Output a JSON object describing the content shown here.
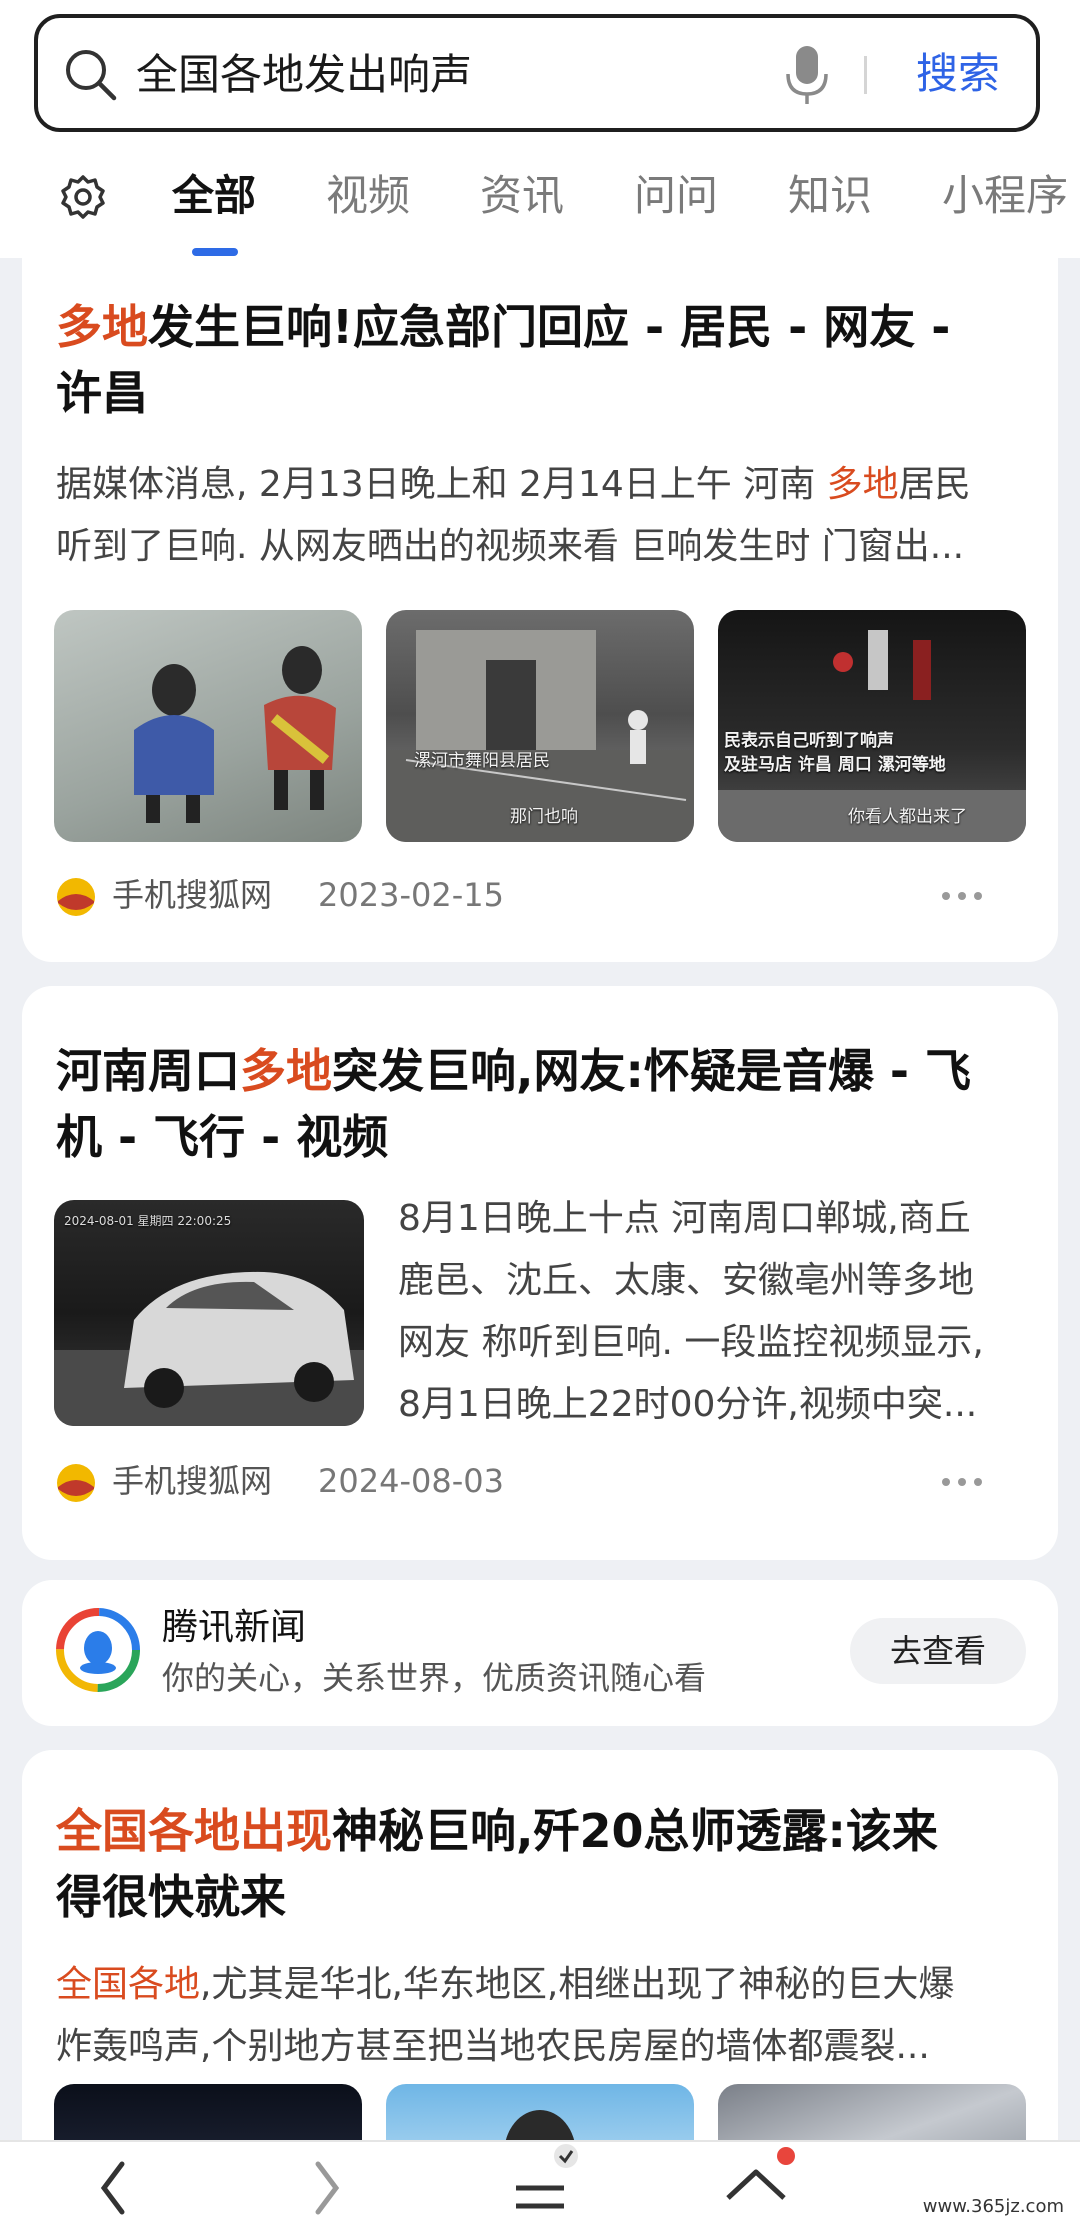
{
  "search": {
    "query": "全国各地发出响声",
    "button_label": "搜索"
  },
  "tabs": [
    "全部",
    "视频",
    "资讯",
    "问问",
    "知识",
    "小程序"
  ],
  "results": [
    {
      "title_hl": "多地",
      "title_rest": "发生巨响!应急部门回应 - 居民 - 网友 -",
      "title_line2": "许昌",
      "snippet_line1_pre": "据媒体消息, 2月13日晚上和 2月14日上午 河南 ",
      "snippet_line1_hl": "多地",
      "snippet_line1_post": "居民",
      "snippet_line2": "听到了巨响. 从网友晒出的视频来看 巨响发生时 门窗出...",
      "thumb_captions": [
        "",
        "漯河市舞阳县居民",
        "那门也响",
        "民表示自己听到了响声",
        "及驻马店 许昌 周口 漯河等地",
        "你看人都出来了"
      ],
      "source": "手机搜狐网",
      "date": "2023-02-15"
    },
    {
      "title_pre": "河南周口",
      "title_hl": "多地",
      "title_post": "突发巨响,网友:怀疑是音爆 - 飞",
      "title_line2": "机 - 飞行 - 视频",
      "thumb_overlay": "2024-08-01  星期四  22:00:25",
      "snippet_lines": [
        "8月1日晚上十点 河南周口郸城,商丘",
        "鹿邑、沈丘、太康、安徽亳州等多地",
        "网友 称听到巨响. 一段监控视频显示,",
        "8月1日晚上22时00分许,视频中突..."
      ],
      "source": "手机搜狐网",
      "date": "2024-08-03"
    },
    {
      "title_hl": "全国各地出现",
      "title_rest": "神秘巨响,歼20总师透露:该来",
      "title_line2": "得很快就来",
      "snippet_line1_hl": "全国各地",
      "snippet_line1_post": ",尤其是华北,华东地区,相继出现了神秘的巨大爆",
      "snippet_line2": "炸轰鸣声,个别地方甚至把当地农民房屋的墙体都震裂..."
    }
  ],
  "ad": {
    "name": "腾讯新闻",
    "slogan": "你的关心，关系世界，优质资讯随心看",
    "button_label": "去查看"
  },
  "watermark": "www.365jz.com",
  "colors": {
    "highlight": "#d94b1f",
    "accent": "#2e63e6"
  }
}
